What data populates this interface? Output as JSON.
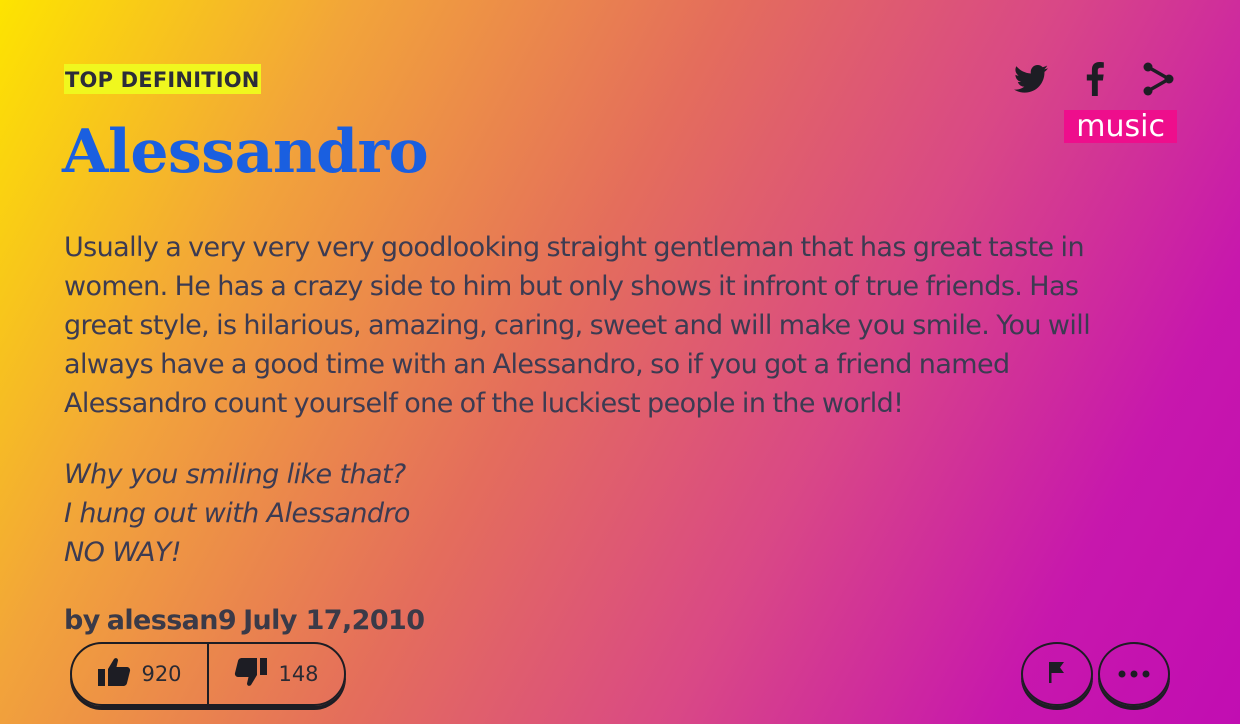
{
  "definition": {
    "label": "TOP DEFINITION",
    "word": "Alessandro",
    "tag": "music",
    "meaning": "Usually a very very very goodlooking straight gentleman that has great taste in women. He has a crazy side to him but only shows it infront of true friends. Has great style, is hilarious, amazing, caring, sweet and will make you smile. You will always have a good time with an Alessandro, so if you got a friend named Alessandro count yourself one of the luckiest people in the world!",
    "example_lines": [
      "Why you smiling like that?",
      "I hung out with Alessandro",
      "NO WAY!"
    ],
    "contributor_prefix": "by",
    "author": "alessan9",
    "date": "July 17,2010"
  },
  "share": {
    "icons": [
      "twitter-icon",
      "facebook-icon",
      "share-icon"
    ]
  },
  "votes": {
    "up": "920",
    "down": "148"
  },
  "actions": {
    "icons": [
      "flag-icon",
      "more-icon"
    ]
  },
  "colors": {
    "label_bg": "#f0f71e",
    "title": "#1a5fe0",
    "tag_bg": "#ee0e8c",
    "gradient_start": "#fde400",
    "gradient_end": "#c10db2"
  }
}
